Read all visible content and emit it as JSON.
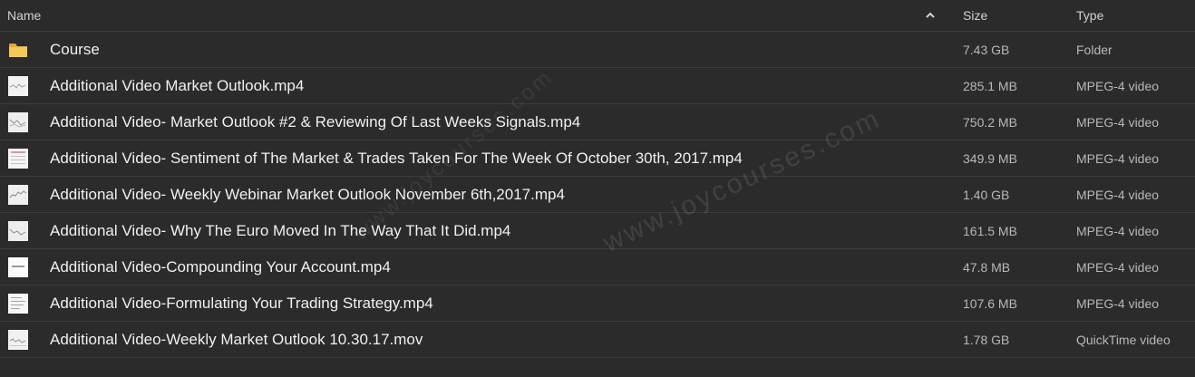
{
  "header": {
    "name_label": "Name",
    "size_label": "Size",
    "type_label": "Type",
    "sort_icon": "chevron-up-icon"
  },
  "files": [
    {
      "name": "Course",
      "size": "7.43 GB",
      "type": "Folder",
      "icon": "folder-icon"
    },
    {
      "name": "Additional Video Market Outlook.mp4",
      "size": "285.1 MB",
      "type": "MPEG-4 video",
      "icon": "video-thumbnail-icon"
    },
    {
      "name": "Additional Video- Market Outlook #2 & Reviewing Of Last Weeks Signals.mp4",
      "size": "750.2 MB",
      "type": "MPEG-4 video",
      "icon": "video-thumbnail-icon"
    },
    {
      "name": "Additional Video- Sentiment of The Market & Trades Taken For The Week Of October 30th, 2017.mp4",
      "size": "349.9 MB",
      "type": "MPEG-4 video",
      "icon": "video-thumbnail-icon"
    },
    {
      "name": "Additional Video- Weekly Webinar Market Outlook November 6th,2017.mp4",
      "size": "1.40 GB",
      "type": "MPEG-4 video",
      "icon": "video-thumbnail-icon"
    },
    {
      "name": "Additional Video- Why The Euro Moved In The Way That It Did.mp4",
      "size": "161.5 MB",
      "type": "MPEG-4 video",
      "icon": "video-thumbnail-icon"
    },
    {
      "name": "Additional Video-Compounding Your Account.mp4",
      "size": "47.8 MB",
      "type": "MPEG-4 video",
      "icon": "video-thumbnail-icon"
    },
    {
      "name": "Additional Video-Formulating Your Trading Strategy.mp4",
      "size": "107.6 MB",
      "type": "MPEG-4 video",
      "icon": "video-thumbnail-icon"
    },
    {
      "name": "Additional Video-Weekly Market Outlook 10.30.17.mov",
      "size": "1.78 GB",
      "type": "QuickTime video",
      "icon": "video-thumbnail-icon"
    }
  ],
  "watermark": "www.joycourses.com",
  "colors": {
    "background": "#2b2b2b",
    "divider": "#3c3c3c",
    "folder": "#f5c85c"
  }
}
